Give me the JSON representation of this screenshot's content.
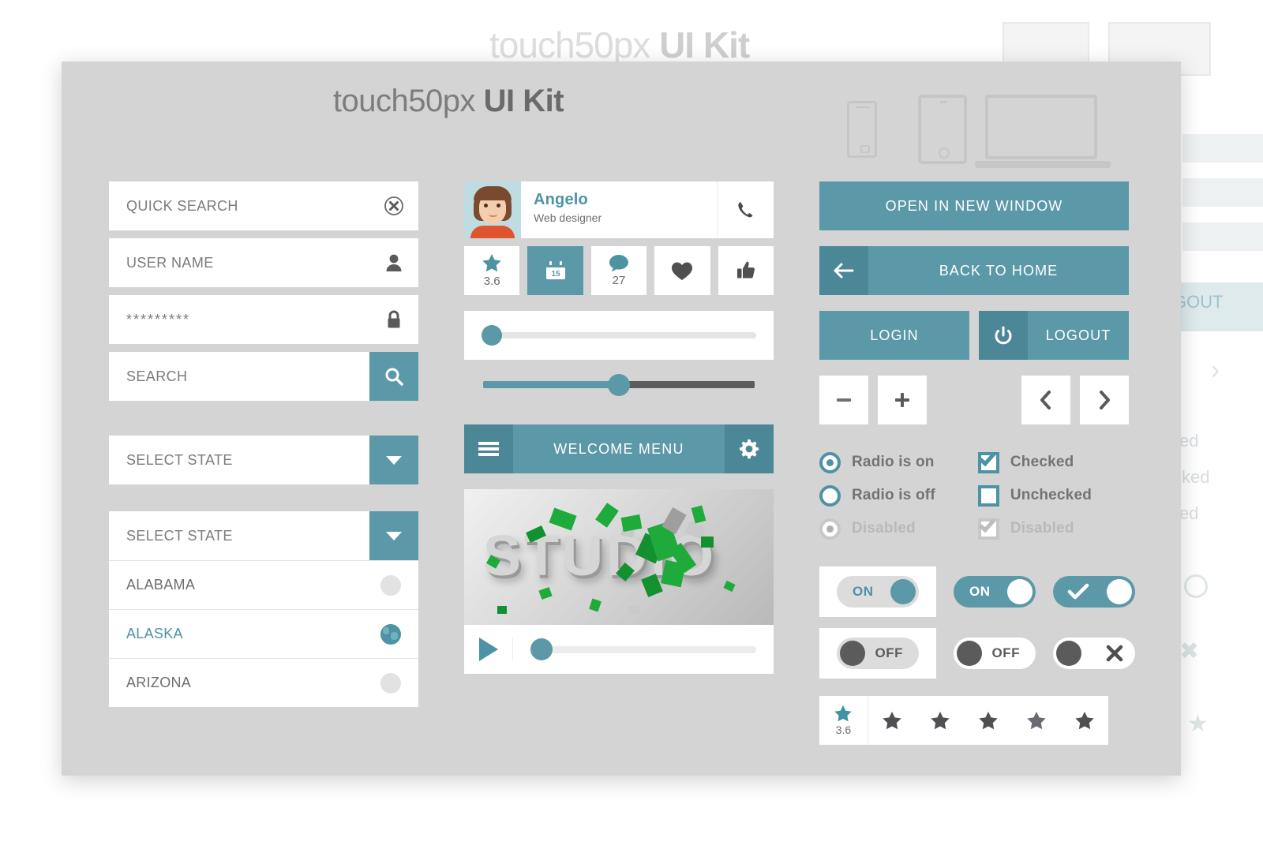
{
  "ghost": {
    "title_regular": "touch50px",
    "title_bold": "UI Kit",
    "logout": "GOUT",
    "checked": "ed",
    "unchecked": "cked",
    "disabled": "ed"
  },
  "header": {
    "title_regular": "touch50px",
    "title_bold": "UI Kit",
    "devices": [
      "phone-icon",
      "tablet-icon",
      "laptop-icon"
    ]
  },
  "colors": {
    "teal": "#5b99a8",
    "teal_dark": "#4b8796",
    "teal_text": "#4e93a3",
    "panel": "#d4d4d4",
    "card": "#ffffff",
    "text_grey": "#7b7b7b"
  },
  "left": {
    "quick_search": {
      "label": "QUICK SEARCH",
      "icon": "clear-circle-x-icon"
    },
    "user_name": {
      "label": "USER NAME",
      "icon": "person-icon"
    },
    "password": {
      "label": "*********",
      "icon": "lock-icon"
    },
    "search": {
      "label": "SEARCH",
      "icon": "search-icon"
    },
    "select_closed": {
      "label": "SELECT STATE",
      "icon": "chevron-down-icon"
    },
    "select_open": {
      "label": "SELECT STATE",
      "icon": "chevron-down-icon"
    },
    "states": [
      {
        "label": "ALABAMA",
        "selected": false
      },
      {
        "label": "ALASKA",
        "selected": true
      },
      {
        "label": "ARIZONA",
        "selected": false
      }
    ]
  },
  "middle": {
    "profile": {
      "name": "Angelo",
      "role": "Web designer",
      "call_icon": "phone-icon"
    },
    "stats": [
      {
        "icon": "star-icon",
        "value": "3.6",
        "active": false
      },
      {
        "icon": "calendar-icon",
        "value": "15",
        "active": true
      },
      {
        "icon": "comment-icon",
        "value": "27",
        "active": false
      },
      {
        "icon": "heart-icon",
        "value": "",
        "active": false
      },
      {
        "icon": "thumbs-up-icon",
        "value": "",
        "active": false
      }
    ],
    "slider_card": {
      "value_percent": 2
    },
    "slider_bare": {
      "value_percent": 48
    },
    "menu": {
      "label": "WELCOME MENU",
      "left_icon": "hamburger-icon",
      "right_icon": "gear-icon"
    },
    "video": {
      "title": "STUDIO",
      "play_icon": "play-icon",
      "progress_percent": 2
    }
  },
  "right": {
    "open_new_window": "OPEN IN NEW WINDOW",
    "back_to_home": {
      "label": "BACK TO HOME",
      "icon": "back-arrow-icon"
    },
    "login": "LOGIN",
    "logout": {
      "label": "LOGOUT",
      "icon": "power-icon"
    },
    "stepper": {
      "minus": "minus-icon",
      "plus": "plus-icon"
    },
    "pager": {
      "prev": "chevron-left-icon",
      "next": "chevron-right-icon"
    },
    "radios": [
      {
        "label": "Radio is on",
        "state": "on"
      },
      {
        "label": "Radio is off",
        "state": "off"
      },
      {
        "label": "Disabled",
        "state": "disabled"
      }
    ],
    "checkboxes": [
      {
        "label": "Checked",
        "state": "checked"
      },
      {
        "label": "Unchecked",
        "state": "unchecked"
      },
      {
        "label": "Disabled",
        "state": "disabled"
      }
    ],
    "toggles": {
      "on_row": [
        {
          "label": "ON",
          "style": "grey-track-teal-knob",
          "carded": true
        },
        {
          "label": "ON",
          "style": "teal-track-white-knob",
          "carded": false
        },
        {
          "label": "check-icon",
          "style": "teal-track-white-knob",
          "carded": false
        }
      ],
      "off_row": [
        {
          "label": "OFF",
          "style": "grey-track-dark-knob",
          "carded": true
        },
        {
          "label": "OFF",
          "style": "white-track-dark-knob",
          "carded": false
        },
        {
          "label": "x-icon",
          "style": "white-track-dark-knob",
          "carded": false
        }
      ]
    },
    "rating": {
      "value": "3.6",
      "filled": 1,
      "total_stars": 5
    }
  }
}
